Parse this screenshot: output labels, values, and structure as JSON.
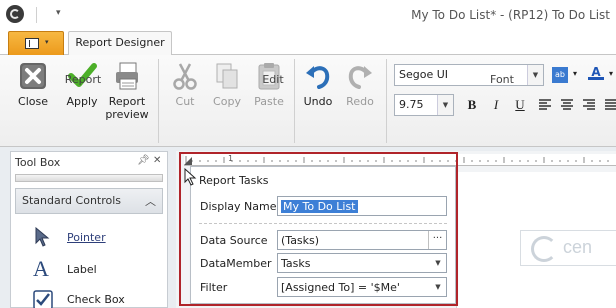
{
  "window": {
    "title": "My To Do List* - (RP12) To Do List",
    "qat_dropdown": "▾"
  },
  "tabs": {
    "file_menu": "▾",
    "report_designer": "Report Designer"
  },
  "ribbon": {
    "groups": {
      "report": "Report",
      "edit": "Edit",
      "font": "Font"
    },
    "buttons": {
      "close": "Close",
      "apply": "Apply",
      "report_preview_line1": "Report",
      "report_preview_line2": "preview",
      "cut": "Cut",
      "copy": "Copy",
      "paste": "Paste",
      "undo": "Undo",
      "redo": "Redo"
    },
    "font_name": "Segoe UI",
    "font_size": "9.75",
    "format_glyphs": {
      "bold": "B",
      "italic": "I",
      "underline": "U",
      "font_color": "A"
    }
  },
  "toolbox": {
    "title": "Tool Box",
    "pin": "ᵖ",
    "close": "✕",
    "group": "Standard Controls",
    "items": [
      {
        "label": "Pointer",
        "icon": "pointer-arrow-icon"
      },
      {
        "label": "Label",
        "icon": "label-a-icon"
      },
      {
        "label": "Check Box",
        "icon": "checkbox-icon"
      }
    ]
  },
  "report_tasks": {
    "title": "Report Tasks",
    "display_name_label": "Display Name",
    "display_name_value": "My To Do List",
    "data_source_label": "Data Source",
    "data_source_value": "(Tasks)",
    "data_source_ellipsis": "···",
    "data_member_label": "DataMember",
    "data_member_value": "Tasks",
    "filter_label": "Filter",
    "filter_value": "[Assigned To] = '$Me'"
  },
  "ruler": {
    "numbers": [
      "1"
    ]
  },
  "watermark_text": "cen",
  "colors": {
    "accent_orange": "#ec9a1c",
    "highlight_red": "#b0242a",
    "selection_blue": "#3d7fd6",
    "apply_green": "#4caf28",
    "undo_blue": "#2c6fb8"
  }
}
